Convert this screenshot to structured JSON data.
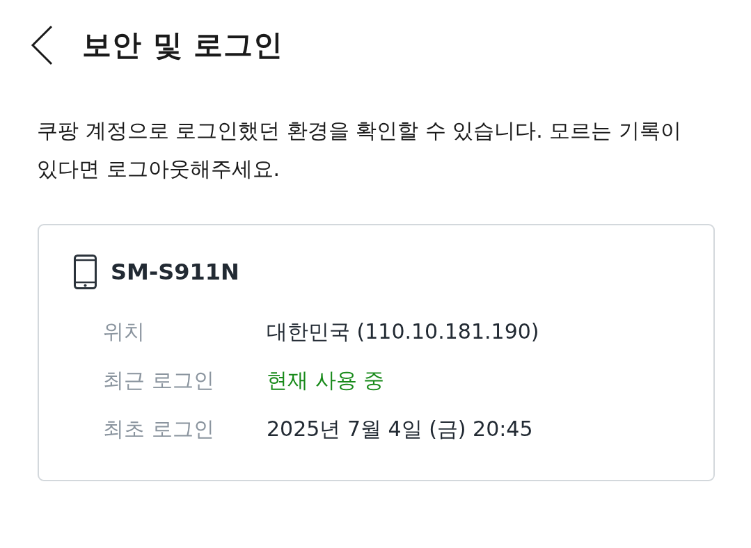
{
  "header": {
    "title": "보안 및 로그인"
  },
  "description": "쿠팡 계정으로 로그인했던 환경을 확인할 수 있습니다. 모르는 기록이 있다면 로그아웃해주세요.",
  "devices": [
    {
      "name": "SM-S911N",
      "details": [
        {
          "label": "위치",
          "value": "대한민국 (110.10.181.190)",
          "kind": "plain"
        },
        {
          "label": "최근 로그인",
          "value": "현재 사용 중",
          "kind": "active"
        },
        {
          "label": "최초 로그인",
          "value": "2025년 7월 4일 (금) 20:45",
          "kind": "plain"
        }
      ]
    }
  ]
}
